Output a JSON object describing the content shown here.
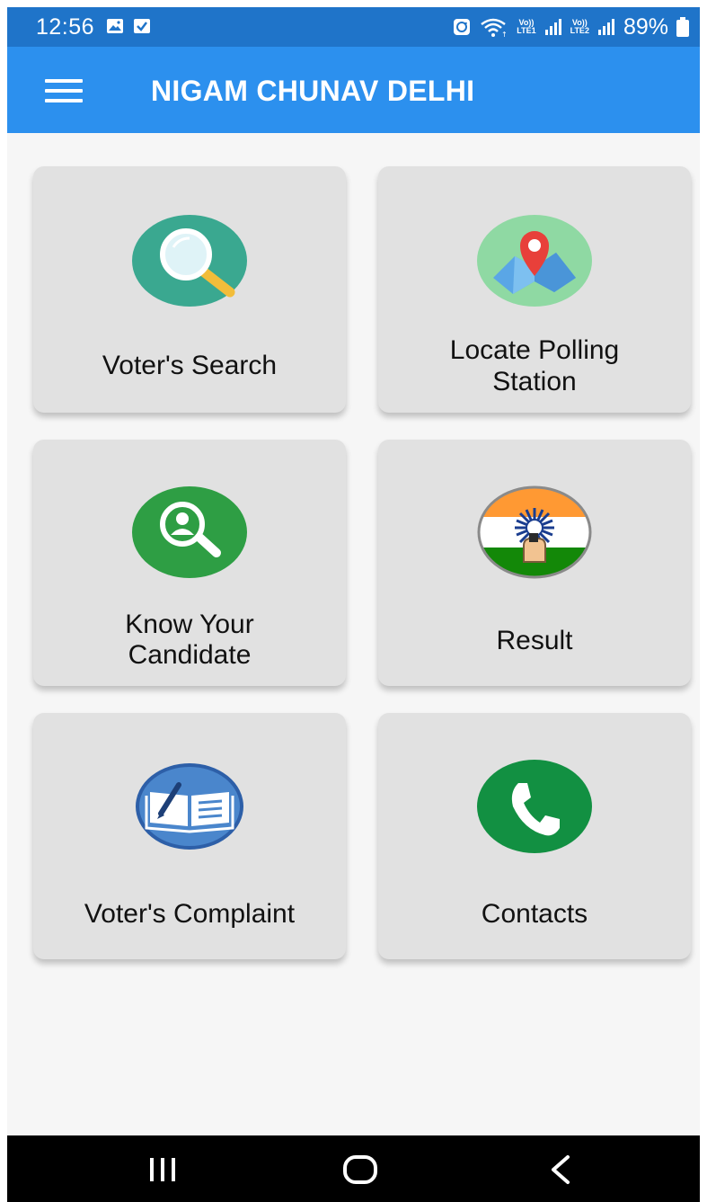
{
  "status_bar": {
    "time": "12:56",
    "battery": "89%",
    "sim1_label_top": "Vo))",
    "sim1_label_bottom": "LTE1",
    "sim2_label_top": "Vo))",
    "sim2_label_bottom": "LTE2",
    "icons": [
      "gallery-icon",
      "checkbox-icon",
      "sync-icon",
      "wifi-icon",
      "signal-icon",
      "battery-icon"
    ]
  },
  "app_bar": {
    "title": "NIGAM CHUNAV DELHI",
    "menu_icon": "hamburger-menu-icon"
  },
  "tiles": [
    {
      "label_1": "Voter's Search",
      "label_2": "",
      "icon": "magnifier-icon",
      "color": "#3aa890"
    },
    {
      "label_1": "Locate Polling",
      "label_2": "Station",
      "icon": "map-pin-icon",
      "color": "#8fd9a3"
    },
    {
      "label_1": "Know Your",
      "label_2": "Candidate",
      "icon": "candidate-search-icon",
      "color": "#2e9e44"
    },
    {
      "label_1": "Result",
      "label_2": "",
      "icon": "election-result-icon",
      "color": "#ff9933"
    },
    {
      "label_1": "Voter's Complaint",
      "label_2": "",
      "icon": "complaint-book-icon",
      "color": "#4a86cc"
    },
    {
      "label_1": "Contacts",
      "label_2": "",
      "icon": "phone-icon",
      "color": "#129042"
    }
  ],
  "nav_bar": {
    "buttons": [
      "recent-apps-icon",
      "home-icon",
      "back-icon"
    ]
  },
  "colors": {
    "status_bar": "#1f74c9",
    "app_bar": "#2c90ee",
    "tile_bg": "#e1e1e1",
    "content_bg": "#f6f6f6"
  }
}
